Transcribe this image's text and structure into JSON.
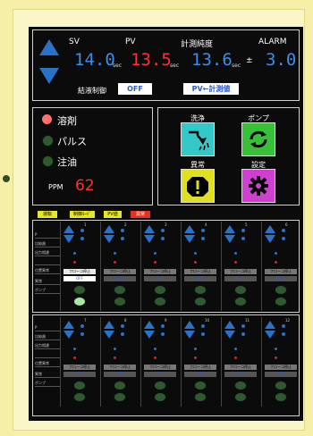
{
  "header": {
    "sv_label": "SV",
    "pv_label": "PV",
    "conc_label": "計測純度",
    "alarm_label": "ALARM",
    "sv_value": "14.0",
    "pv_value": "13.5",
    "conc_value": "13.6",
    "alarm_value": "3.0",
    "unit": "sec",
    "plusminus": "±",
    "temp_label": "結液制御",
    "off_label": "OFF",
    "copy_label": "PV←計測値"
  },
  "status": {
    "items": [
      {
        "label": "溶剤",
        "color": "#ff7070"
      },
      {
        "label": "パルス",
        "color": "#2f5a2f"
      },
      {
        "label": "注油",
        "color": "#2f5a2f"
      }
    ],
    "ppm_label": "PPM",
    "ppm_value": "62"
  },
  "actions": [
    {
      "label": "洗浄",
      "color": "#34c8c8",
      "icon": "shower-icon"
    },
    {
      "label": "ポンプ",
      "color": "#38c038",
      "icon": "refresh-icon"
    },
    {
      "label": "異常",
      "color": "#e0e020",
      "icon": "alert-icon"
    },
    {
      "label": "設定",
      "color": "#d040d0",
      "icon": "gear-icon"
    }
  ],
  "tabs": [
    {
      "label": "運転",
      "color": "#e8e820"
    },
    {
      "label": "制御ﾓｰﾄﾞ",
      "color": "#e8e820"
    },
    {
      "label": "PV値",
      "color": "#e8e820"
    },
    {
      "label": "異常",
      "color": "#e83020"
    }
  ],
  "grid": {
    "side_top": [
      "P",
      "比較器",
      "出力相違",
      "",
      "位置異常",
      "異常",
      "ポンプ"
    ],
    "side_bottom": [
      "P",
      "比較器",
      "出力相違",
      "",
      "位置異常",
      "異常",
      "ポンプ"
    ],
    "ch_top": [
      "1",
      "2",
      "3",
      "4",
      "5",
      "6"
    ],
    "ch_bottom": [
      "7",
      "8",
      "9",
      "10",
      "11",
      "12"
    ],
    "chip1": "フローコ停止",
    "chip2": "OFF"
  }
}
